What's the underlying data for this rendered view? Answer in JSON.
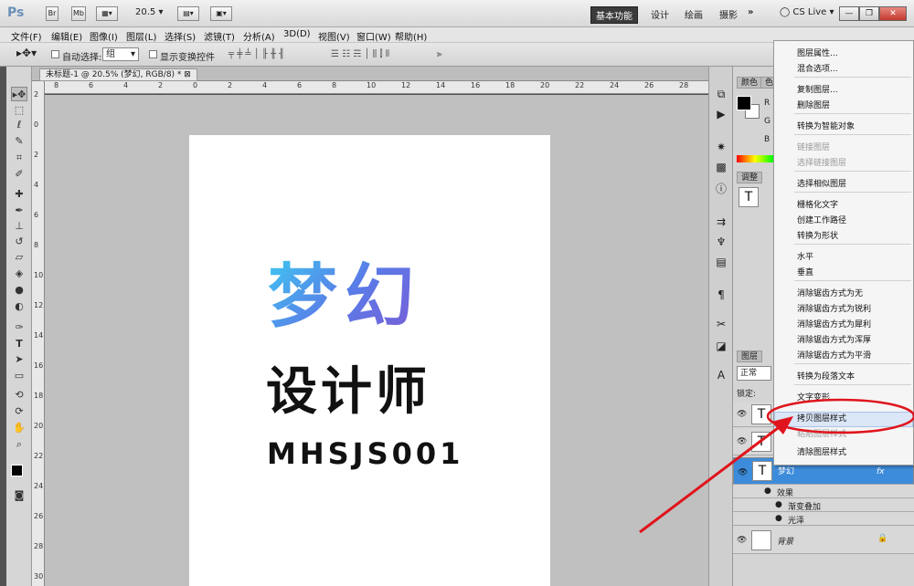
{
  "titlebar": {
    "logo": "Ps",
    "btn_br": "Br",
    "btn_mb": "Mb",
    "zoom": "20.5",
    "workspaces": [
      "基本功能",
      "设计",
      "绘画",
      "摄影"
    ],
    "more": "»",
    "cslive": "CS Live"
  },
  "menu": [
    "文件(F)",
    "编辑(E)",
    "图像(I)",
    "图层(L)",
    "选择(S)",
    "滤镜(T)",
    "分析(A)",
    "3D(D)",
    "视图(V)",
    "窗口(W)",
    "帮助(H)"
  ],
  "options": {
    "auto_select_label": "自动选择:",
    "auto_select_value": "组",
    "show_transform": "显示变换控件"
  },
  "document": {
    "tab_title": "未标题-1 @ 20.5% (梦幻, RGB/8) *",
    "title_art": "梦幻",
    "subtitle": "设计师",
    "code": "MHSJS001"
  },
  "ruler_h": [
    "8",
    "6",
    "4",
    "2",
    "0",
    "2",
    "4",
    "6",
    "8",
    "10",
    "12",
    "14",
    "16",
    "18",
    "20",
    "22",
    "24",
    "26",
    "28"
  ],
  "ruler_v": [
    "2",
    "0",
    "2",
    "4",
    "6",
    "8",
    "10",
    "12",
    "14",
    "16",
    "18",
    "20",
    "22",
    "24",
    "26",
    "28",
    "30"
  ],
  "panels": {
    "color_tab": "颜色",
    "swatch_tab": "色",
    "adjust_tab": "调整",
    "layers_tab": "图层",
    "r": "R",
    "g": "G",
    "b": "B",
    "blend_mode": "正常",
    "lock_label": "锁定:"
  },
  "layers": [
    {
      "name": "梦幻",
      "thumb": "T",
      "fx": "fx"
    },
    {
      "name": "效果"
    },
    {
      "name": "渐变叠加"
    },
    {
      "name": "光泽"
    },
    {
      "name": "背景"
    }
  ],
  "context_menu": [
    {
      "label": "图层属性...",
      "enabled": true
    },
    {
      "label": "混合选项...",
      "enabled": true
    },
    {
      "label": "复制图层...",
      "enabled": true
    },
    {
      "label": "删除图层",
      "enabled": true
    },
    {
      "label": "转换为智能对象",
      "enabled": true
    },
    {
      "label": "链接图层",
      "enabled": false
    },
    {
      "label": "选择链接图层",
      "enabled": false
    },
    {
      "label": "选择相似图层",
      "enabled": true
    },
    {
      "label": "栅格化文字",
      "enabled": true
    },
    {
      "label": "创建工作路径",
      "enabled": true
    },
    {
      "label": "转换为形状",
      "enabled": true
    },
    {
      "label": "水平",
      "enabled": true
    },
    {
      "label": "垂直",
      "enabled": true
    },
    {
      "label": "消除锯齿方式为无",
      "enabled": true
    },
    {
      "label": "消除锯齿方式为锐利",
      "enabled": true
    },
    {
      "label": "消除锯齿方式为犀利",
      "enabled": true
    },
    {
      "label": "消除锯齿方式为浑厚",
      "enabled": true
    },
    {
      "label": "消除锯齿方式为平滑",
      "enabled": true
    },
    {
      "label": "转换为段落文本",
      "enabled": true
    },
    {
      "label": "文字变形...",
      "enabled": true
    },
    {
      "label": "拷贝图层样式",
      "enabled": true
    },
    {
      "label": "粘贴图层样式",
      "enabled": false
    },
    {
      "label": "清除图层样式",
      "enabled": true
    }
  ],
  "colors": {
    "annotation_red": "#e0141c",
    "layer_selected": "#3d8cdb"
  }
}
